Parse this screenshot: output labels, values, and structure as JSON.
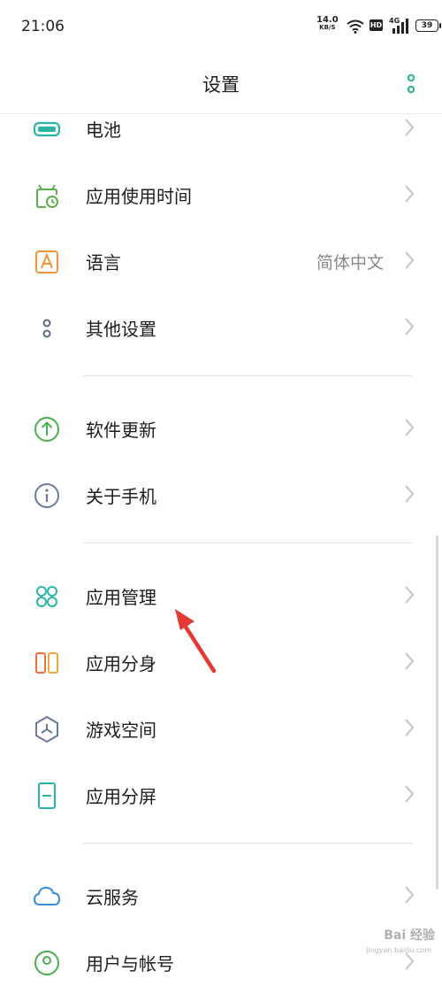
{
  "status_bar": {
    "time": "21:06",
    "net_speed_value": "14.0",
    "net_speed_unit": "KB/S",
    "hd_badge": "HD",
    "network_type": "4G",
    "battery": "39"
  },
  "header": {
    "title": "设置",
    "more_icon": "more-vertical-icon"
  },
  "rows": [
    {
      "label": "电池",
      "icon": "battery-icon",
      "color": "#2bb5a5"
    },
    {
      "label": "应用使用时间",
      "icon": "screen-time-icon",
      "color": "#5fae4c"
    },
    {
      "label": "语言",
      "value": "简体中文",
      "icon": "language-icon",
      "color": "#f0963a"
    },
    {
      "label": "其他设置",
      "icon": "other-settings-icon",
      "color": "#5c6b8a"
    },
    {
      "label": "软件更新",
      "icon": "update-icon",
      "color": "#4caf50"
    },
    {
      "label": "关于手机",
      "icon": "info-icon",
      "color": "#6a7a9a"
    },
    {
      "label": "应用管理",
      "icon": "apps-icon",
      "color": "#2bb5a5"
    },
    {
      "label": "应用分身",
      "icon": "app-clone-icon",
      "color": "#f06f3a"
    },
    {
      "label": "游戏空间",
      "icon": "game-space-icon",
      "color": "#6a7a9a"
    },
    {
      "label": "应用分屏",
      "icon": "split-screen-icon",
      "color": "#2bb5a5"
    },
    {
      "label": "云服务",
      "icon": "cloud-icon",
      "color": "#3a8fd9"
    },
    {
      "label": "用户与帐号",
      "icon": "user-account-icon",
      "color": "#4caf50"
    }
  ],
  "watermark": {
    "text": "Bai 经验",
    "sub": "jingyan.baidu.com"
  }
}
